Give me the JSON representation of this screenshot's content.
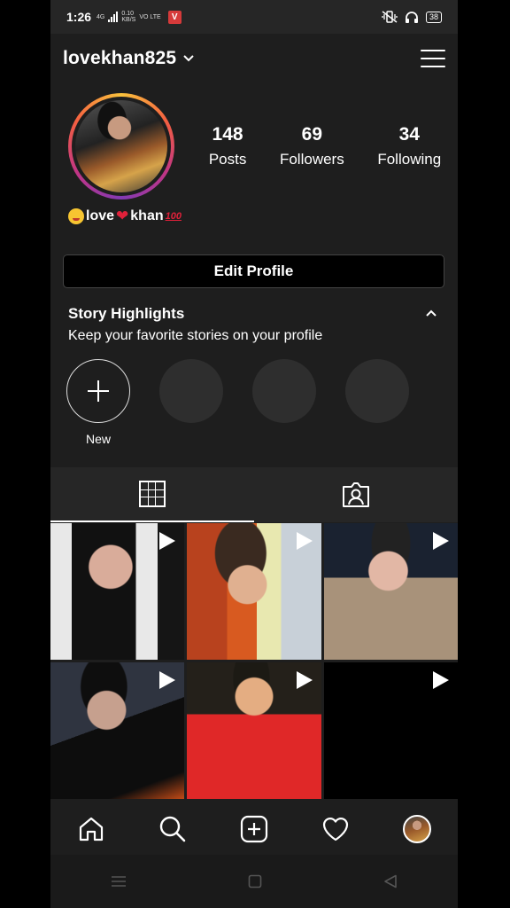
{
  "status_bar": {
    "time": "1:26",
    "net_type": "4G",
    "speed": "0.10",
    "speed_unit": "KB/S",
    "volte": "VO LTE",
    "app_badge": "V",
    "battery": "38"
  },
  "header": {
    "username": "lovekhan825"
  },
  "profile": {
    "stats": [
      {
        "value": "148",
        "label": "Posts"
      },
      {
        "value": "69",
        "label": "Followers"
      },
      {
        "value": "34",
        "label": "Following"
      }
    ],
    "bio": {
      "part1": "love",
      "part2": "khan",
      "suffix": "100"
    },
    "edit_button": "Edit Profile"
  },
  "highlights": {
    "title": "Story Highlights",
    "subtitle": "Keep your favorite stories on your profile",
    "new_label": "New"
  },
  "tabs": [
    {
      "icon": "grid-icon",
      "active": true
    },
    {
      "icon": "tagged-icon",
      "active": false
    }
  ],
  "posts": [
    {
      "type": "video"
    },
    {
      "type": "video"
    },
    {
      "type": "video"
    },
    {
      "type": "video"
    },
    {
      "type": "video"
    },
    {
      "type": "video"
    }
  ],
  "bottom_nav": [
    "home-icon",
    "search-icon",
    "add-post-icon",
    "activity-heart-icon",
    "profile-avatar"
  ],
  "colors": {
    "background": "#1e1e1e",
    "accent_ring": [
      "#f9c23c",
      "#f56040",
      "#c13584",
      "#833ab4"
    ],
    "heart": "#e0213a"
  }
}
